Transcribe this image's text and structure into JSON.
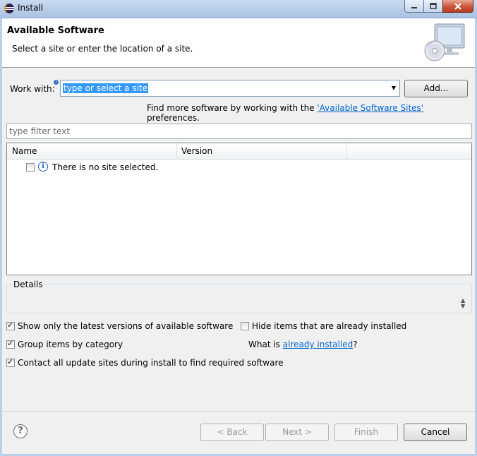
{
  "window": {
    "title": "Install",
    "controls": [
      "minimize-icon",
      "maximize-icon",
      "close-icon"
    ]
  },
  "header": {
    "title": "Available Software",
    "description": "Select a site or enter the location of a site.",
    "image": "computer-cd-icon"
  },
  "work_with": {
    "label": "Work with:",
    "value": "type or select a site",
    "add_label": "Add...",
    "find_more_prefix": "Find more software by working with the ",
    "find_more_link": "'Available Software Sites'",
    "find_more_suffix": " preferences."
  },
  "filter": {
    "placeholder": "type filter text"
  },
  "table": {
    "columns": [
      "Name",
      "Version"
    ],
    "rows": [
      {
        "checked": false,
        "icon": "info-icon",
        "text": "There is no site selected."
      }
    ]
  },
  "details": {
    "label": "Details"
  },
  "options": {
    "show_latest": {
      "label": "Show only the latest versions of available software",
      "checked": true
    },
    "hide_installed": {
      "label": "Hide items that are already installed",
      "checked": false
    },
    "group_by_category": {
      "label": "Group items by category",
      "checked": true
    },
    "what_is_prefix": "What is ",
    "what_is_link": "already installed",
    "what_is_suffix": "?",
    "contact_sites": {
      "label": "Contact all update sites during install to find required software",
      "checked": true
    }
  },
  "footer": {
    "help_icon": "help-icon",
    "back_label": "< Back",
    "next_label": "Next >",
    "finish_label": "Finish",
    "cancel_label": "Cancel"
  }
}
